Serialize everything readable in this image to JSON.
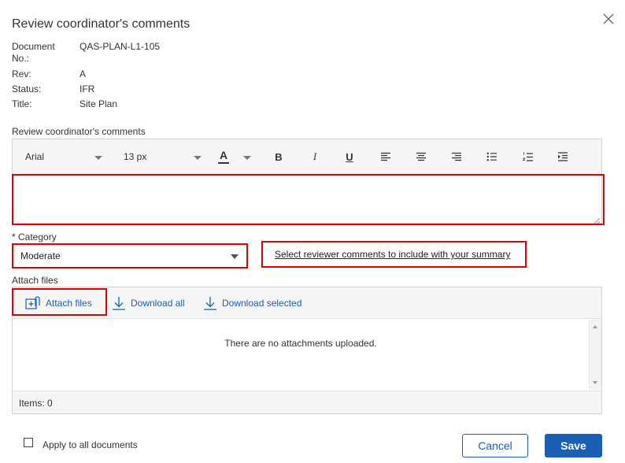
{
  "dialog": {
    "title": "Review coordinator's comments",
    "close_icon": "close-icon"
  },
  "document": {
    "doc_no_label_line1": "Document",
    "doc_no_label_line2": "No.:",
    "doc_no_value": "QAS-PLAN-L1-105",
    "rev_label": "Rev:",
    "rev_value": "A",
    "status_label": "Status:",
    "status_value": "IFR",
    "title_label": "Title:",
    "title_value": "Site Plan"
  },
  "editor": {
    "label": "Review coordinator's comments",
    "font_family": "Arial",
    "font_size": "13 px",
    "font_color_glyph": "A",
    "bold_glyph": "B",
    "italic_glyph": "I",
    "underline_glyph": "U",
    "value": ""
  },
  "category": {
    "label": "* Category",
    "selected": "Moderate",
    "reviewer_link": "Select reviewer comments to include with your summary"
  },
  "attachments": {
    "label": "Attach files",
    "attach_button": "Attach files",
    "download_all": "Download all",
    "download_selected": "Download selected",
    "empty_message": "There are no attachments uploaded.",
    "items_count": "Items: 0"
  },
  "footer": {
    "apply_all_label": "Apply to all documents",
    "cancel_label": "Cancel",
    "save_label": "Save"
  },
  "colors": {
    "accent": "#1a5fb4",
    "highlight": "#e00000"
  }
}
